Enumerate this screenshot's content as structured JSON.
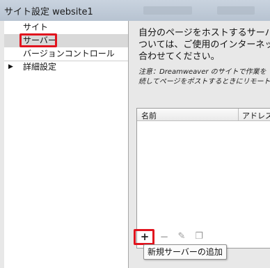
{
  "window": {
    "title": "サイト設定 website1"
  },
  "sidebar": {
    "items": [
      {
        "label": "サイト"
      },
      {
        "label": "サーバー"
      },
      {
        "label": "バージョンコントロール"
      },
      {
        "label": "詳細設定",
        "expand_icon": "triangle-right-icon"
      }
    ],
    "selected_index": 1
  },
  "main": {
    "description_lines": [
      "自分のページをホストするサーバー",
      "ついては、ご使用のインターネット",
      "合わせてください。"
    ],
    "note_lines": [
      "注意：Dreamweaver のサイトで作業を",
      "続してページをポストするときにリモートサ"
    ],
    "table": {
      "columns": [
        "名前",
        "アドレス"
      ]
    },
    "toolbar": {
      "add_icon": "plus-icon",
      "remove_icon": "minus-icon",
      "edit_icon": "pencil-icon",
      "duplicate_icon": "duplicate-icon"
    },
    "tooltip": "新規サーバーの追加"
  },
  "colors": {
    "highlight": "#e1141e",
    "selected_row": "#d9d9d9"
  }
}
